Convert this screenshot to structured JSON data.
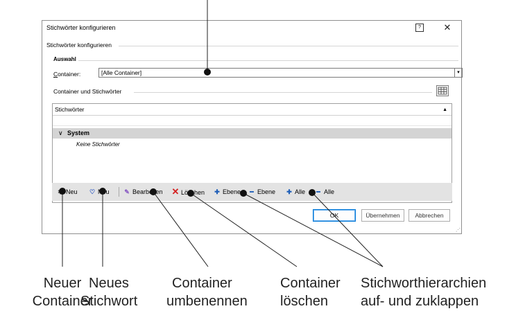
{
  "dialog": {
    "title": "Stichwörter konfigurieren",
    "help_glyph": "?",
    "close_glyph": "✕",
    "section_label": "Stichwörter konfigurieren",
    "auswahl_label": "Auswahl",
    "container_label_first": "C",
    "container_label_rest": "ontainer:",
    "container_value": "[Alle Container]",
    "tree_section_label": "Container und Stichwörter",
    "list_header": "Stichwörter",
    "group_name": "System",
    "empty_text": "Keine Stichwörter",
    "toolbar": {
      "neu_container": "Neu",
      "neu_stichwort": "Neu",
      "bearbeiten": "Bearbeiten",
      "loeschen": "Löschen",
      "ebene_plus": "Ebene",
      "ebene_minus": "Ebene",
      "alle_plus": "Alle",
      "alle_minus": "Alle"
    },
    "buttons": {
      "ok": "OK",
      "apply": "Übernehmen",
      "cancel": "Abbrechen"
    }
  },
  "callouts": {
    "neuer_container": [
      "Neuer",
      "Container"
    ],
    "neues_stichwort": [
      "Neues",
      "Stichwort"
    ],
    "container_umbenennen": [
      "Container",
      "umbenennen"
    ],
    "container_loeschen": [
      "Container",
      "löschen"
    ],
    "hierarchien": [
      "Stichworthierarchien",
      "auf- und zuklappen"
    ]
  },
  "colors": {
    "accent_blue": "#0078d7",
    "delete_red": "#d42020",
    "plus_blue": "#1f5fb8",
    "edit_purple": "#8a5cc4",
    "toolbar_bg": "#e3e3e3",
    "group_row_bg": "#d4d4d4"
  },
  "icons": [
    "help-icon",
    "close-icon",
    "dropdown-arrow-icon",
    "grid-icon",
    "sort-arrow-icon",
    "chevron-down-icon",
    "new-container-icon",
    "new-keyword-icon",
    "pencil-icon",
    "delete-x-icon",
    "plus-icon",
    "minus-icon"
  ]
}
